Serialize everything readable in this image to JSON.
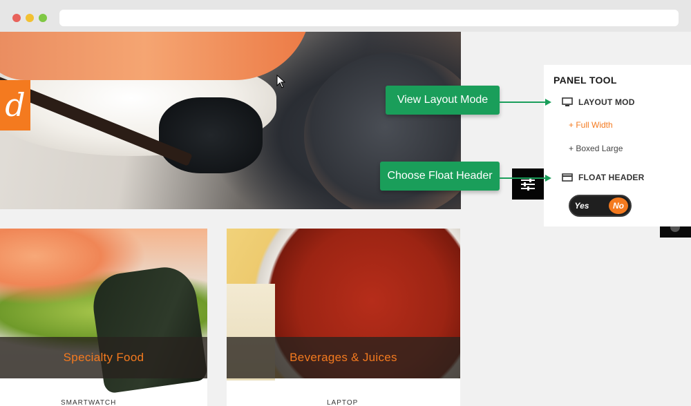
{
  "browser": {
    "window_controls": [
      "close",
      "minimize",
      "maximize"
    ]
  },
  "hero": {
    "logo_letter": "d"
  },
  "cards": [
    {
      "title": "Specialty Food",
      "subtitle": "SMARTWATCH"
    },
    {
      "title": "Beverages & Juices",
      "subtitle": "LAPTOP"
    }
  ],
  "panel": {
    "title": "PANEL TOOL",
    "layout_label": "LAYOUT MOD",
    "layout_icon": "monitor-icon",
    "options": [
      "+ Full Width",
      "+ Boxed Large"
    ],
    "float_label": "FLOAT HEADER",
    "float_icon": "header-card-icon",
    "toggle": {
      "yes": "Yes",
      "no": "No",
      "selected": "No"
    }
  },
  "callouts": {
    "layout": "View Layout Mode",
    "float": "Choose Float Header"
  },
  "colors": {
    "accent": "#f47a1f",
    "callout_green": "#1a9e5a"
  }
}
